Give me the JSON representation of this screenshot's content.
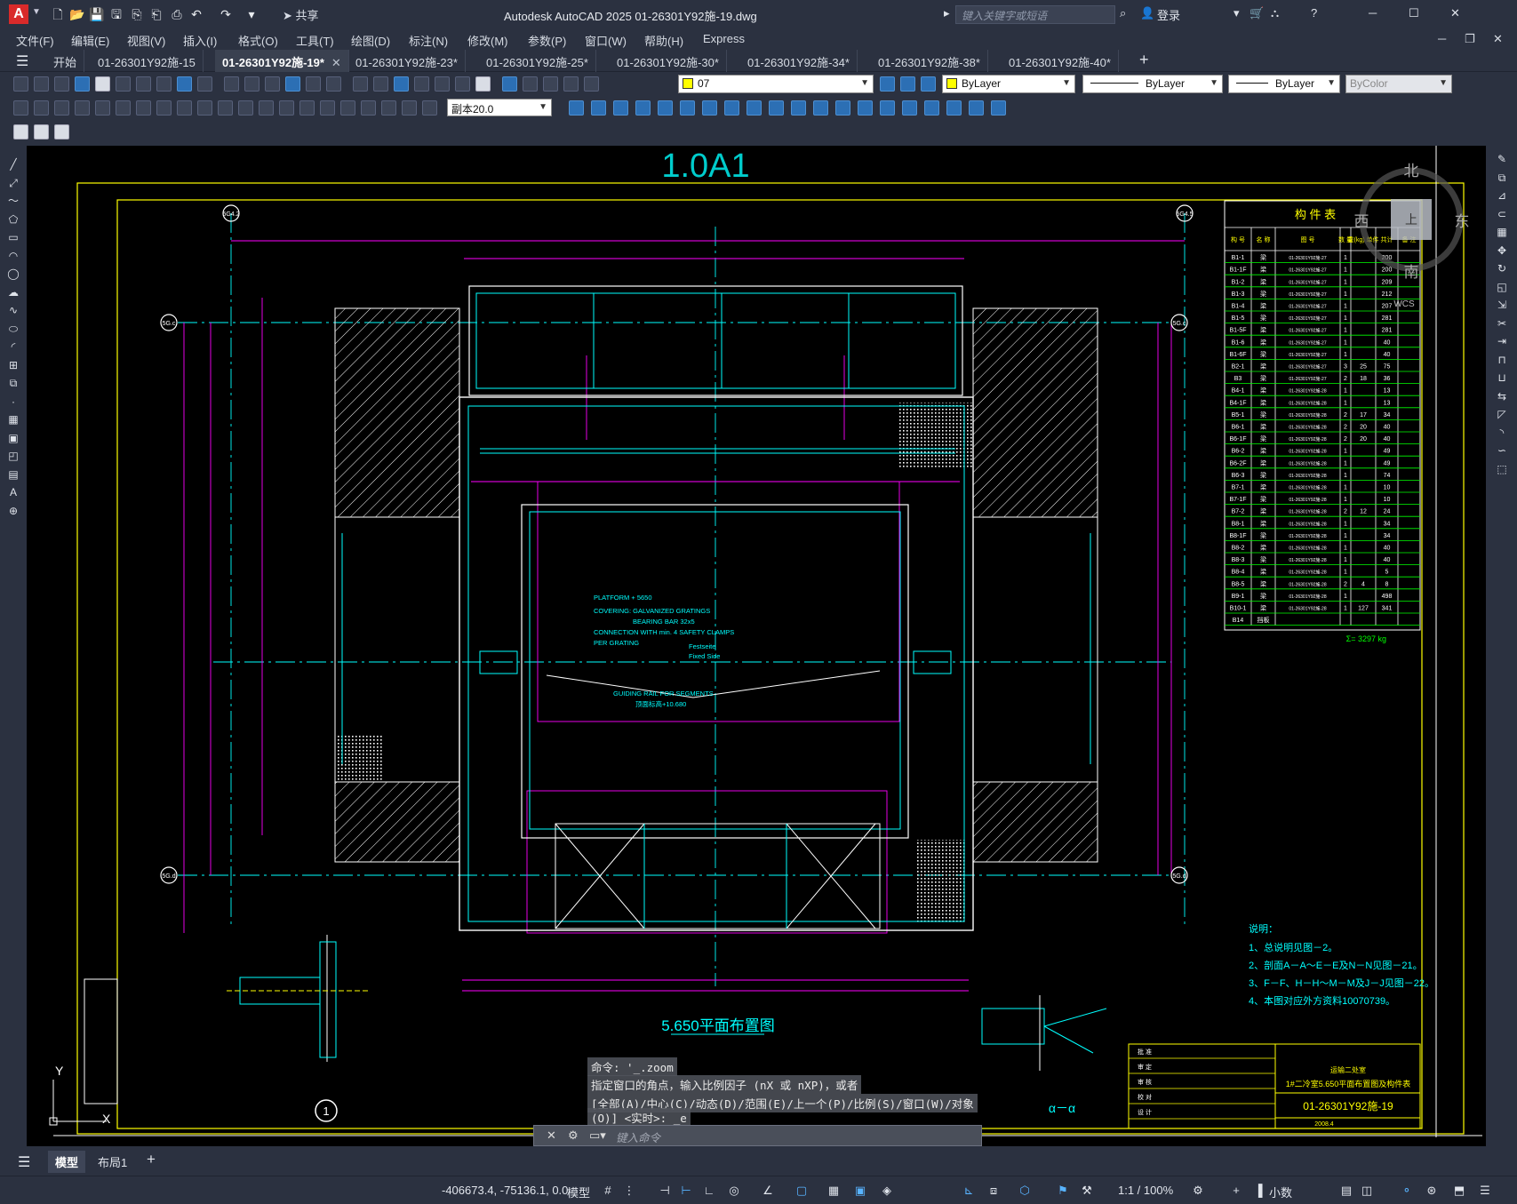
{
  "window": {
    "title": "Autodesk AutoCAD 2025    01-26301Y92施-19.dwg",
    "share": "共享",
    "search_placeholder": "键入关键字或短语",
    "login": "登录"
  },
  "menu": [
    "文件(F)",
    "编辑(E)",
    "视图(V)",
    "插入(I)",
    "格式(O)",
    "工具(T)",
    "绘图(D)",
    "标注(N)",
    "修改(M)",
    "参数(P)",
    "窗口(W)",
    "帮助(H)",
    "Express"
  ],
  "tabs": [
    {
      "label": "开始",
      "active": false
    },
    {
      "label": "01-26301Y92施-15",
      "active": false
    },
    {
      "label": "01-26301Y92施-19*",
      "active": true
    },
    {
      "label": "01-26301Y92施-23*",
      "active": false
    },
    {
      "label": "01-26301Y92施-25*",
      "active": false
    },
    {
      "label": "01-26301Y92施-30*",
      "active": false
    },
    {
      "label": "01-26301Y92施-34*",
      "active": false
    },
    {
      "label": "01-26301Y92施-38*",
      "active": false
    },
    {
      "label": "01-26301Y92施-40*",
      "active": false
    }
  ],
  "properties": {
    "layer": "07",
    "color": "ByLayer",
    "linetype": "ByLayer",
    "lineweight": "ByLayer",
    "plotstyle": "ByColor",
    "dimstyle": "副本20.0"
  },
  "drawing": {
    "view_label": "1.0A1",
    "plan_title": "5.650平面布置图",
    "section_label": "α－α",
    "detail_number": "1",
    "weight_total": "Σ= 3297 kg",
    "notes_title": "说明：",
    "notes": [
      "1、总说明见图－2。",
      "2、剖面A－A～E－E及N－N见图－21。",
      "3、F－F、H－H～M－M及J－J见图－22。",
      "4、本图对应外方资料10070739。"
    ],
    "platform_note": [
      "PLATFORM + 5650",
      "COVERING: GALVANIZED GRATINGS",
      "BEARING BAR 32x5",
      "CONNECTION WITH min. 4 SAFETY CLAMPS",
      "PER GRATING"
    ],
    "guide_note": [
      "GUIDING RAIL FOR SEGMENTS",
      "顶面标高+10.680"
    ],
    "fixed_side": [
      "Festseite",
      "Fixed Side"
    ],
    "parts_table": {
      "title": "构    件    表",
      "headers": [
        "构 号",
        "名 称",
        "图 号",
        "数 量",
        "重(kg) 单件",
        "共计",
        "备 注"
      ],
      "rows": [
        [
          "B1-1",
          "梁",
          "01-26301Y92施-27",
          "1",
          "",
          "200",
          ""
        ],
        [
          "B1-1F",
          "梁",
          "01-26301Y92施-27",
          "1",
          "",
          "200",
          ""
        ],
        [
          "B1-2",
          "梁",
          "01-26301Y92施-27",
          "1",
          "",
          "209",
          ""
        ],
        [
          "B1-3",
          "梁",
          "01-26301Y92施-27",
          "1",
          "",
          "212",
          ""
        ],
        [
          "B1-4",
          "梁",
          "01-26301Y92施-27",
          "1",
          "",
          "207",
          ""
        ],
        [
          "B1-5",
          "梁",
          "01-26301Y92施-27",
          "1",
          "",
          "281",
          ""
        ],
        [
          "B1-5F",
          "梁",
          "01-26301Y92施-27",
          "1",
          "",
          "281",
          ""
        ],
        [
          "B1-6",
          "梁",
          "01-26301Y92施-27",
          "1",
          "",
          "40",
          ""
        ],
        [
          "B1-6F",
          "梁",
          "01-26301Y92施-27",
          "1",
          "",
          "40",
          ""
        ],
        [
          "B2-1",
          "梁",
          "01-26301Y92施-27",
          "3",
          "25",
          "75",
          ""
        ],
        [
          "B3",
          "梁",
          "01-26301Y92施-27",
          "2",
          "18",
          "36",
          ""
        ],
        [
          "B4-1",
          "梁",
          "01-26301Y92施-28",
          "1",
          "",
          "13",
          ""
        ],
        [
          "B4-1F",
          "梁",
          "01-26301Y92施-28",
          "1",
          "",
          "13",
          ""
        ],
        [
          "B5-1",
          "梁",
          "01-26301Y92施-28",
          "2",
          "17",
          "34",
          ""
        ],
        [
          "B6-1",
          "梁",
          "01-26301Y92施-28",
          "2",
          "20",
          "40",
          ""
        ],
        [
          "B6-1F",
          "梁",
          "01-26301Y92施-28",
          "2",
          "20",
          "40",
          ""
        ],
        [
          "B6-2",
          "梁",
          "01-26301Y92施-28",
          "1",
          "",
          "49",
          ""
        ],
        [
          "B6-2F",
          "梁",
          "01-26301Y92施-28",
          "1",
          "",
          "49",
          ""
        ],
        [
          "B6-3",
          "梁",
          "01-26301Y92施-28",
          "1",
          "",
          "74",
          ""
        ],
        [
          "B7-1",
          "梁",
          "01-26301Y92施-28",
          "1",
          "",
          "10",
          ""
        ],
        [
          "B7-1F",
          "梁",
          "01-26301Y92施-28",
          "1",
          "",
          "10",
          ""
        ],
        [
          "B7-2",
          "梁",
          "01-26301Y92施-28",
          "2",
          "12",
          "24",
          ""
        ],
        [
          "B8-1",
          "梁",
          "01-26301Y92施-28",
          "1",
          "",
          "34",
          ""
        ],
        [
          "B8-1F",
          "梁",
          "01-26301Y92施-28",
          "1",
          "",
          "34",
          ""
        ],
        [
          "B8-2",
          "梁",
          "01-26301Y92施-28",
          "1",
          "",
          "40",
          ""
        ],
        [
          "B8-3",
          "梁",
          "01-26301Y92施-28",
          "1",
          "",
          "40",
          ""
        ],
        [
          "B8-4",
          "梁",
          "01-26301Y92施-28",
          "1",
          "",
          "5",
          ""
        ],
        [
          "B8-5",
          "梁",
          "01-26301Y92施-28",
          "2",
          "4",
          "8",
          ""
        ],
        [
          "B9-1",
          "梁",
          "01-26301Y92施-28",
          "1",
          "",
          "498",
          ""
        ],
        [
          "B10-1",
          "梁",
          "01-26301Y92施-28",
          "1",
          "127",
          "341",
          ""
        ],
        [
          "B14",
          "挡板",
          "",
          "",
          "",
          "",
          ""
        ]
      ]
    },
    "title_block": {
      "roles": [
        "批 准",
        "审 定",
        "审 核",
        "校 对",
        "设 计"
      ],
      "company": "运输二处室",
      "drawing_name": "1#二冷室5.650平面布置图及构件表",
      "drawing_no": "01-26301Y92施-19",
      "date": "2008.4"
    },
    "grid_bubbles": [
      "5G4.2",
      "5G4.5",
      "5G.c",
      "5G.c",
      "5G.d",
      "5G.d"
    ],
    "compass": {
      "n": "北",
      "s": "南",
      "e": "东",
      "w": "西",
      "top": "上",
      "wcs": "WCS"
    }
  },
  "command": {
    "history": [
      "命令: '_.zoom",
      "指定窗口的角点，输入比例因子 (nX 或 nXP)，或者",
      "[全部(A)/中心(C)/动态(D)/范围(E)/上一个(P)/比例(S)/窗口(W)/对象",
      "(O)] <实时>: _e"
    ],
    "placeholder": "键入命令"
  },
  "layout_tabs": {
    "model": "模型",
    "layout1": "布局1"
  },
  "status": {
    "coords": "-406673.4, -75136.1, 0.0",
    "space": "模型",
    "scale": "1:1 / 100%",
    "units": "小数"
  },
  "colors": {
    "background": "#000000",
    "chrome": "#2b3140",
    "cyan": "#00ffff",
    "magenta": "#ff00ff",
    "yellow": "#ffff00",
    "green": "#00ff00",
    "white": "#ffffff"
  }
}
